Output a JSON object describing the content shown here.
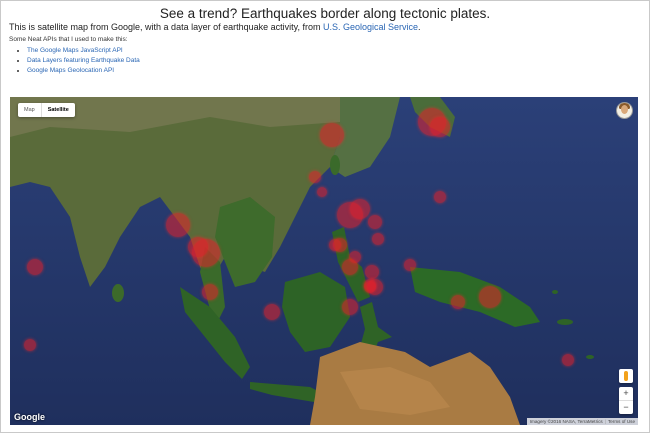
{
  "header": {
    "title": "See a trend? Earthquakes border along tectonic plates.",
    "description_prefix": "This is satellite map from Google, with a data layer of earthquake activity, from ",
    "description_link": "U.S. Geological Service",
    "description_suffix": "."
  },
  "apis": {
    "label": "Some Neat APIs that I used to make this:",
    "items": [
      "The Google Maps JavaScript API",
      "Data Layers featuring Earthquake Data",
      "Google Maps Geolocation API"
    ]
  },
  "map": {
    "map_type": {
      "map_label": "Map",
      "satellite_label": "Satellite",
      "selected": "Satellite"
    },
    "zoom": {
      "in_label": "+",
      "out_label": "−"
    },
    "logo": "Google",
    "attribution": "Imagery ©2016 NASA, TerraMetrics",
    "terms": "Terms of Use",
    "colors": {
      "ocean": "#26386a",
      "land": "#3f6a2a",
      "quake": "#e8202a",
      "link": "#2a66b4"
    }
  }
}
